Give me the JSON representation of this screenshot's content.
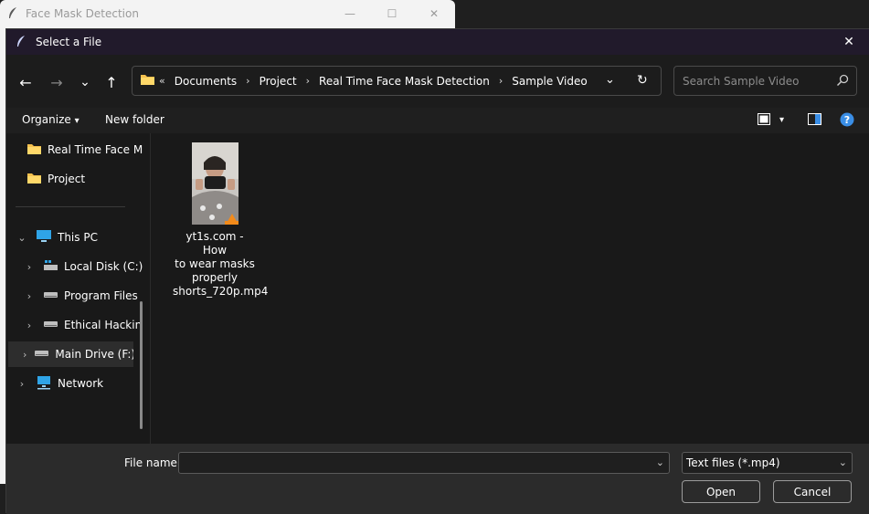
{
  "background_window": {
    "title": "Face Mask Detection",
    "controls": {
      "minimize": "—",
      "maximize": "☐",
      "close": "✕"
    }
  },
  "dialog": {
    "title": "Select a File",
    "close": "✕"
  },
  "nav": {
    "back": "←",
    "forward": "→",
    "recent": "⌄",
    "up": "↑",
    "overflow": "«",
    "breadcrumbs": [
      "Documents",
      "Project",
      "Real Time Face Mask Detection",
      "Sample Video"
    ],
    "separator": "›",
    "dropdown": "⌄",
    "refresh": "↻",
    "search_placeholder": "Search Sample Video"
  },
  "toolbar": {
    "organize": "Organize",
    "organize_arrow": "▾",
    "new_folder": "New folder",
    "view_arrow": "▾"
  },
  "sidebar": {
    "items": [
      {
        "label": "Real Time Face M",
        "icon": "folder-icon"
      },
      {
        "label": "Project",
        "icon": "folder-icon"
      },
      {
        "label": "This PC",
        "icon": "computer-icon",
        "expanded": true
      },
      {
        "label": "Local Disk (C:)",
        "icon": "windows-drive-icon"
      },
      {
        "label": "Program Files",
        "icon": "drive-icon"
      },
      {
        "label": "Ethical Hackin",
        "icon": "drive-icon"
      },
      {
        "label": "Main Drive (F:)",
        "icon": "drive-icon",
        "selected": true
      },
      {
        "label": "Network",
        "icon": "network-icon"
      }
    ],
    "expand_arrow": "›",
    "collapse_arrow": "⌄"
  },
  "files": [
    {
      "name": "yt1s.com - How to wear masks properly shorts_720p.mp4",
      "lines": [
        "yt1s.com - How",
        "to wear masks",
        "properly",
        "shorts_720p.mp4"
      ],
      "icon": "video-thumbnail"
    }
  ],
  "footer": {
    "file_name_label": "File name:",
    "file_name_value": "",
    "file_type": "Text files (*.mp4)",
    "dropdown": "⌄",
    "open": "Open",
    "cancel": "Cancel"
  },
  "colors": {
    "dialog_bg": "#191919",
    "titlebar_bg": "#211a2b",
    "folder": "#f4c04e",
    "help": "#3a8ee6"
  }
}
